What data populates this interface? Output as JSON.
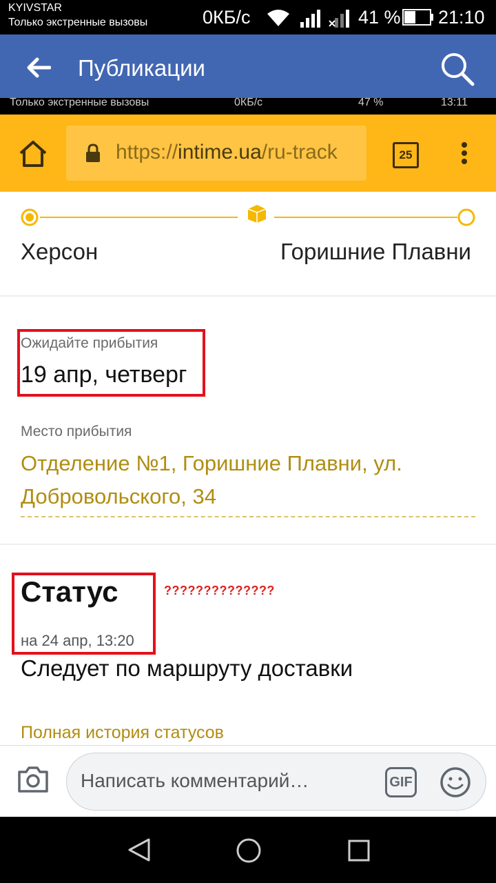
{
  "status_bar": {
    "carrier": "KYIVSTAR",
    "emergency": "Только экстренные вызовы",
    "speed": "0КБ/с",
    "battery": "41 %",
    "time": "21:10"
  },
  "app_bar": {
    "title": "Публикации",
    "back_icon": "arrow-left-icon",
    "search_icon": "search-icon"
  },
  "embedded_strip": {
    "text": "Только экстренные вызовы",
    "speed": "0КБ/с",
    "battery": "47 %",
    "time": "13:11"
  },
  "browser": {
    "url_prefix": "https://",
    "url_domain": "intime.ua",
    "url_path": "/ru-track",
    "tab_count": "25",
    "accent": "#ffb617"
  },
  "route": {
    "from": "Херсон",
    "to": "Горишние Плавни"
  },
  "delivery": {
    "expect_label": "Ожидайте прибытия",
    "expect_date": "19 апр, четверг",
    "place_label": "Место прибытия",
    "place_value": "Отделение №1, Горишние Плавни, ул. Добровольского, 34"
  },
  "status": {
    "title": "Статус",
    "time": "на 24 апр, 13:20",
    "value": "Следует по маршруту доставки",
    "annotation": "??????????????",
    "history_link": "Полная история статусов"
  },
  "comment_bar": {
    "placeholder": "Написать комментарий…",
    "gif": "GIF"
  }
}
